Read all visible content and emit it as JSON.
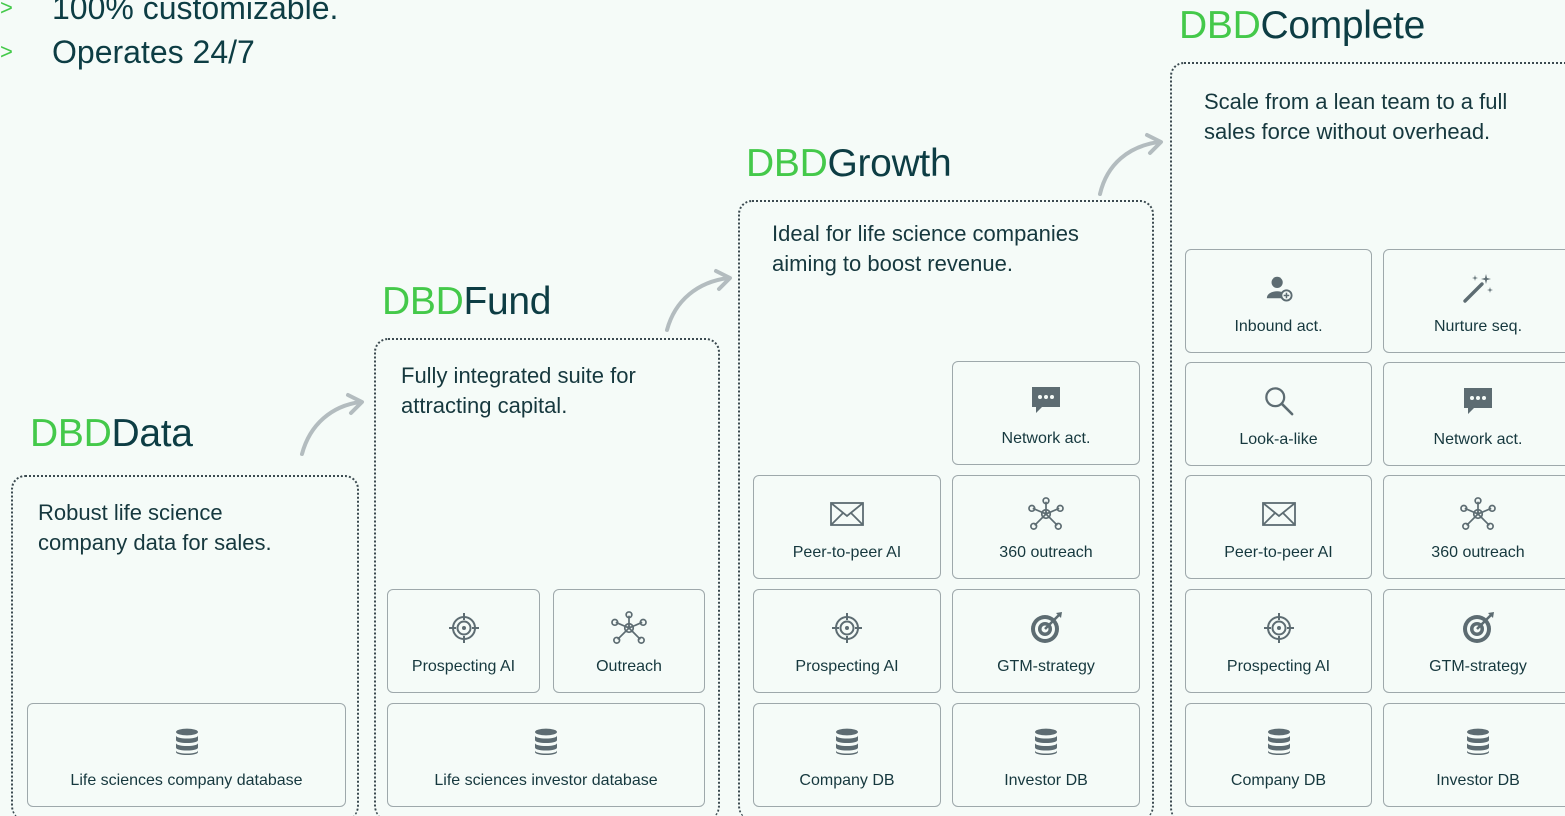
{
  "bullets": [
    "100% customizable.",
    "Operates 24/7"
  ],
  "bullet_marker": ">",
  "colors": {
    "brand_green": "#44c94a",
    "dark_teal": "#0d3d44",
    "icon_gray": "#5d6c72",
    "background": "#f5fbf8"
  },
  "tiers": [
    {
      "brand": "DBD",
      "name": "Data",
      "description": "Robust life science company data for sales.",
      "cards": [
        {
          "label": "Life sciences company database",
          "icon": "database-icon"
        }
      ]
    },
    {
      "brand": "DBD",
      "name": "Fund",
      "description": "Fully integrated suite for attracting capital.",
      "cards": [
        {
          "label": "Prospecting AI",
          "icon": "crosshair-icon"
        },
        {
          "label": "Outreach",
          "icon": "network-icon"
        },
        {
          "label": "Life sciences investor database",
          "icon": "database-icon"
        }
      ]
    },
    {
      "brand": "DBD",
      "name": "Growth",
      "description": "Ideal for life science companies aiming to boost revenue.",
      "cards": [
        {
          "label": "Network act.",
          "icon": "chat-icon"
        },
        {
          "label": "Peer-to-peer AI",
          "icon": "envelope-icon"
        },
        {
          "label": "360 outreach",
          "icon": "network-icon"
        },
        {
          "label": "Prospecting AI",
          "icon": "crosshair-icon"
        },
        {
          "label": "GTM-strategy",
          "icon": "target-icon"
        },
        {
          "label": "Company DB",
          "icon": "database-icon"
        },
        {
          "label": "Investor DB",
          "icon": "database-icon"
        }
      ]
    },
    {
      "brand": "DBD",
      "name": "Complete",
      "description": "Scale from a lean team to a full sales force without overhead.",
      "cards": [
        {
          "label": "Inbound act.",
          "icon": "user-add-icon"
        },
        {
          "label": "Nurture seq.",
          "icon": "magic-wand-icon"
        },
        {
          "label": "Look-a-like",
          "icon": "search-icon"
        },
        {
          "label": "Network act.",
          "icon": "chat-icon"
        },
        {
          "label": "Peer-to-peer AI",
          "icon": "envelope-icon"
        },
        {
          "label": "360 outreach",
          "icon": "network-icon"
        },
        {
          "label": "Prospecting AI",
          "icon": "crosshair-icon"
        },
        {
          "label": "GTM-strategy",
          "icon": "target-icon"
        },
        {
          "label": "Company DB",
          "icon": "database-icon"
        },
        {
          "label": "Investor DB",
          "icon": "database-icon"
        }
      ]
    }
  ]
}
